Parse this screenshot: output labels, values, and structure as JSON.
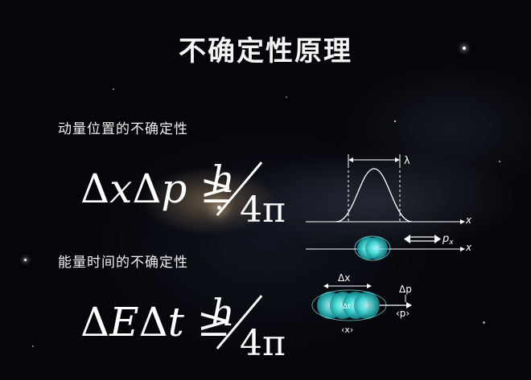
{
  "title": "不确定性原理",
  "section1": {
    "label": "动量位置的不确定性",
    "formula_lhs_a": "Δ",
    "formula_lhs_b": "x",
    "formula_lhs_c": "Δ",
    "formula_lhs_d": "p",
    "relation": "≥",
    "numerator": "h",
    "denominator": "4π"
  },
  "section2": {
    "label": "能量时间的不确定性",
    "formula_lhs_a": "Δ",
    "formula_lhs_b": "E",
    "formula_lhs_c": "Δ",
    "formula_lhs_d": "t",
    "relation": "≥",
    "numerator": "h",
    "denominator": "4π"
  },
  "diagram_top": {
    "lambda_label": "λ",
    "axis_label_1": "x",
    "axis_label_2": "x",
    "momentum_label": "p",
    "momentum_sub": "x"
  },
  "diagram_bottom": {
    "delta_x_label": "Δx",
    "delta_p_label": "Δp",
    "mean_p_label": "‹p›",
    "mean_x_label": "‹x›",
    "center_text": "Δt"
  },
  "colors": {
    "cyan": "#4fe3e0",
    "cyan_dark": "#0f8f95",
    "text": "#ffffff"
  }
}
